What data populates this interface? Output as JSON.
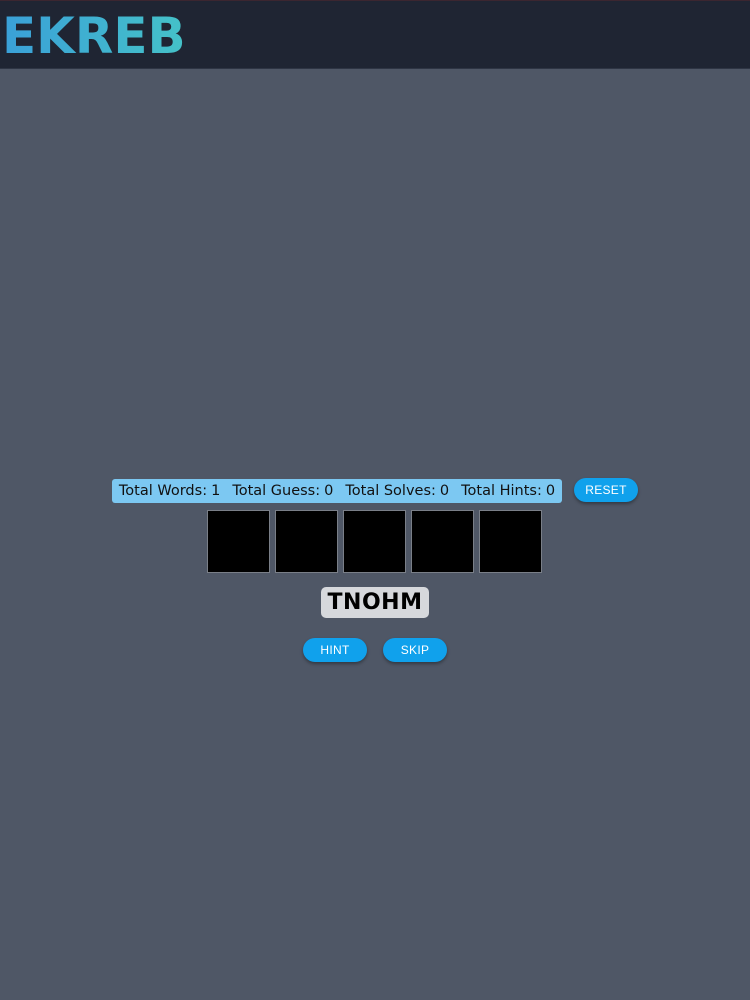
{
  "header": {
    "logo": "EKREB"
  },
  "stats": [
    {
      "label": "Total Words:",
      "value": "1"
    },
    {
      "label": "Total Guess:",
      "value": "0"
    },
    {
      "label": "Total Solves:",
      "value": "0"
    },
    {
      "label": "Total Hints:",
      "value": "0"
    }
  ],
  "buttons": {
    "reset": "RESET",
    "hint": "HINT",
    "skip": "SKIP"
  },
  "puzzle": {
    "scrambled_word": "TNOHM",
    "tile_count": 5
  },
  "colors": {
    "background": "#4f5766",
    "header": "#1f2533",
    "accent": "#10a1ec",
    "stats_bg": "#7cc8f2"
  }
}
